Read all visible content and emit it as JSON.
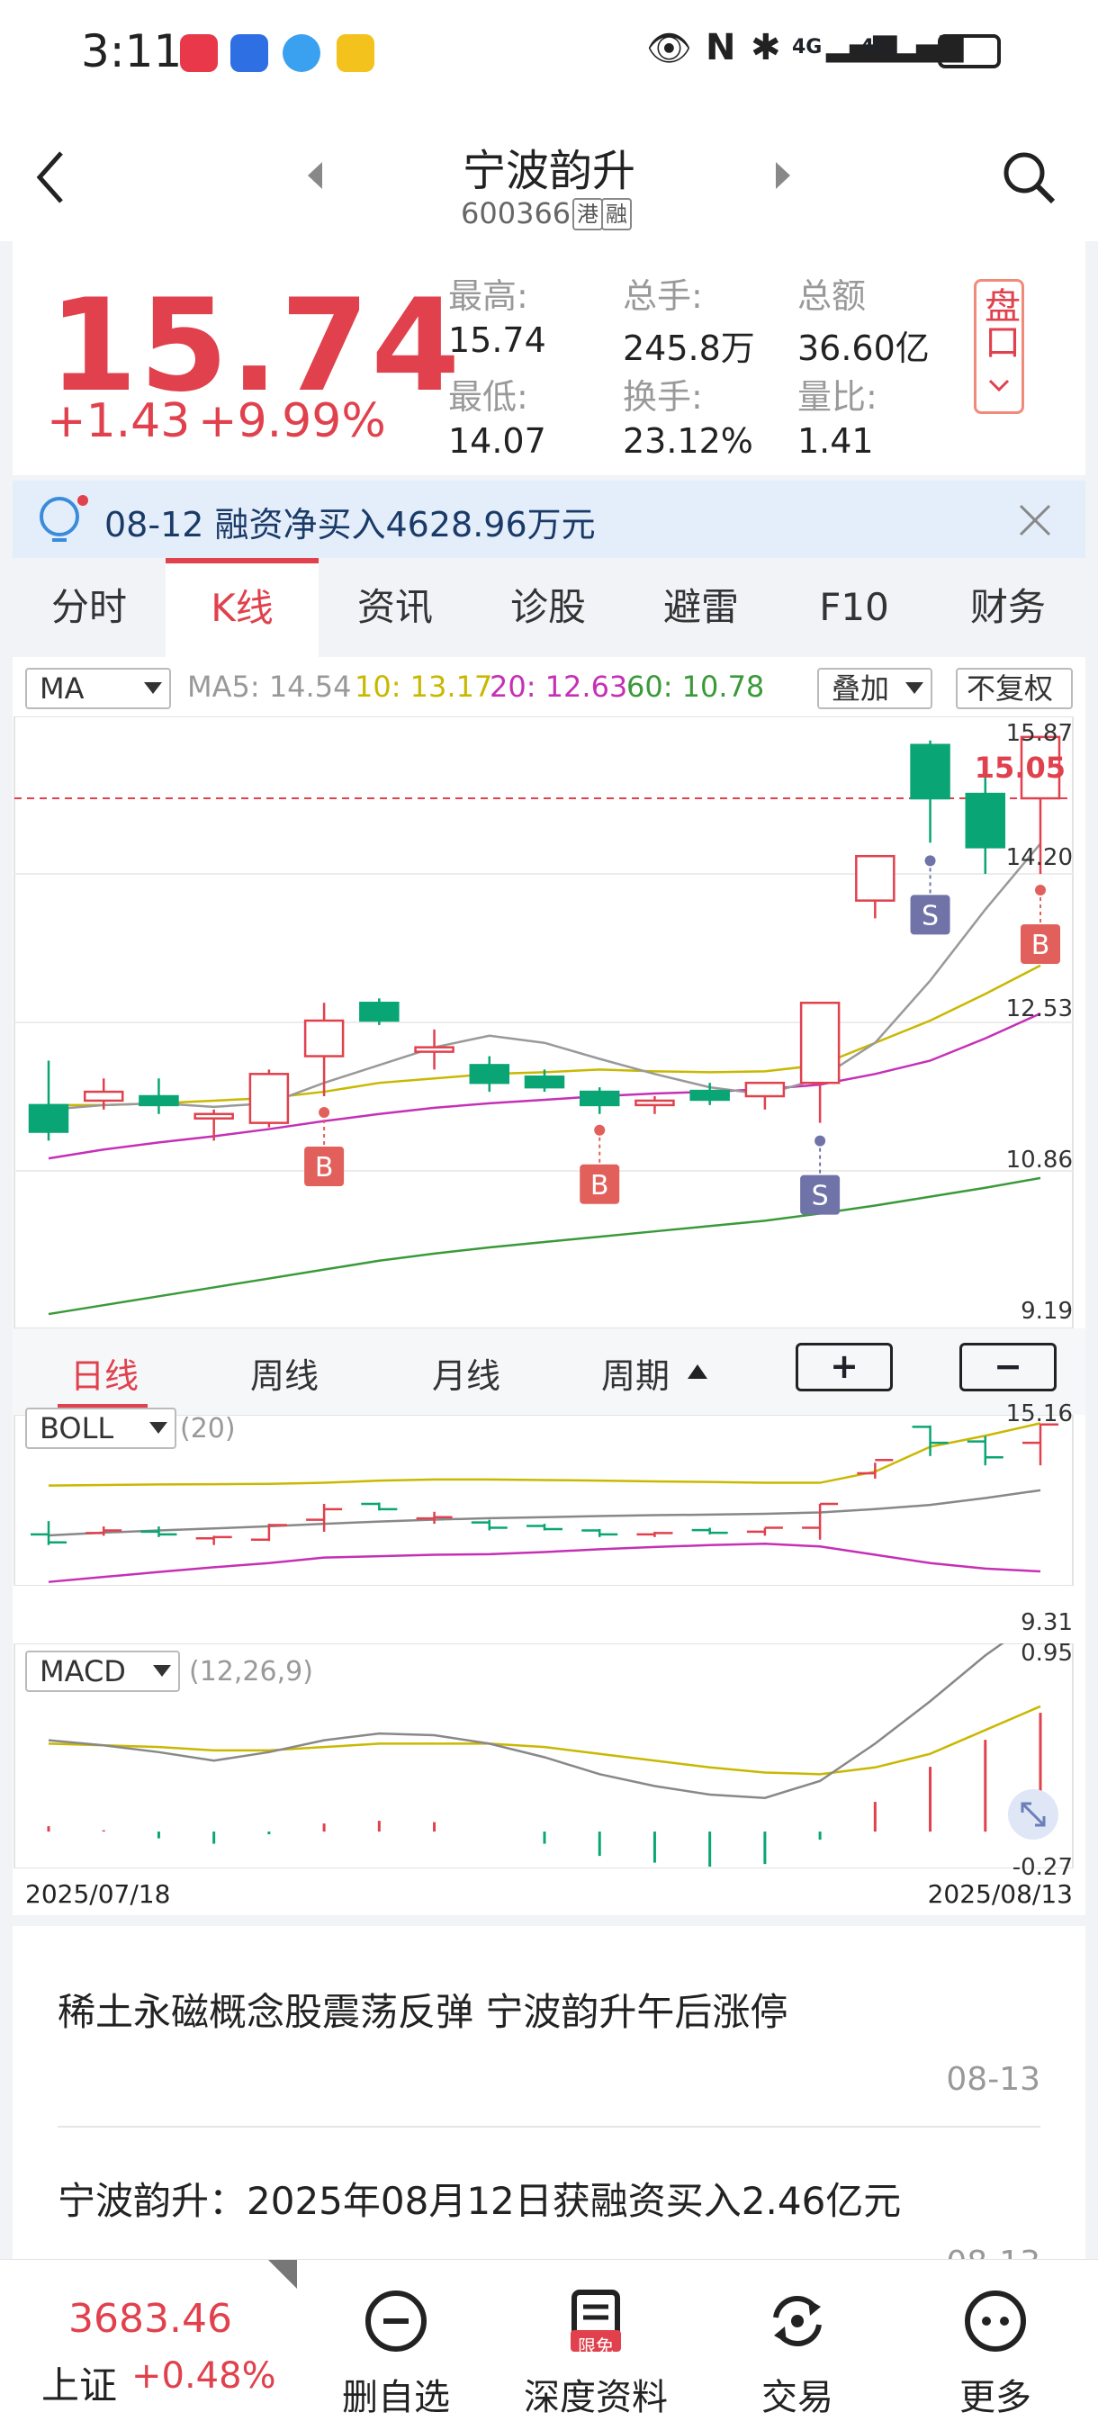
{
  "status_bar": {
    "time": "3:11",
    "network_a": "4G",
    "network_b": "4G"
  },
  "header": {
    "title": "宁波韵升",
    "code": "600366",
    "tag_hk": "港",
    "tag_margin": "融"
  },
  "quote": {
    "price": "15.74",
    "change": "+1.43",
    "change_pct": "+9.99%",
    "fields": [
      {
        "label": "最高:",
        "value": "15.74"
      },
      {
        "label": "总手:",
        "value": "245.8万"
      },
      {
        "label": "总额",
        "value": "36.60亿"
      },
      {
        "label": "最低:",
        "value": "14.07"
      },
      {
        "label": "换手:",
        "value": "23.12%"
      },
      {
        "label": "量比:",
        "value": "1.41"
      }
    ],
    "pankou_label": "盘口"
  },
  "notice": {
    "text": "08-12 融资净买入4628.96万元"
  },
  "tabs": [
    "分时",
    "K线",
    "资讯",
    "诊股",
    "避雷",
    "F10",
    "财务"
  ],
  "active_tab": 1,
  "chart": {
    "ma_selector": "MA",
    "ma_legend": [
      {
        "label": "MA5: 14.54",
        "color": "#999999"
      },
      {
        "label": "10: 13.17",
        "color": "#c9b800"
      },
      {
        "label": "20: 12.63",
        "color": "#c530b5"
      },
      {
        "label": "60: 10.78",
        "color": "#3a9a3a"
      }
    ],
    "overlay_btn": "叠加",
    "adjust_btn": "不复权",
    "price_axis": [
      "15.87",
      "14.20",
      "12.53",
      "10.86",
      "9.19"
    ],
    "current_price_label": "15.05",
    "period_tabs": [
      "日线",
      "周线",
      "月线",
      "周期"
    ],
    "zoom_in": "+",
    "zoom_out": "−",
    "boll_selector": "BOLL",
    "boll_params": "(20)",
    "boll_axis_top": "15.16",
    "boll_axis_bottom": "9.31",
    "macd_selector": "MACD",
    "macd_params": "(12,26,9)",
    "macd_axis_top": "0.95",
    "macd_axis_bottom": "-0.27",
    "date_start": "2025/07/18",
    "date_end": "2025/08/13",
    "signal_buy": "B",
    "signal_sell": "S"
  },
  "chart_data": {
    "type": "candlestick",
    "ylim": [
      9.19,
      15.87
    ],
    "candles": [
      {
        "o": 11.6,
        "h": 12.1,
        "l": 11.2,
        "c": 11.3
      },
      {
        "o": 11.65,
        "h": 11.9,
        "l": 11.55,
        "c": 11.75
      },
      {
        "o": 11.7,
        "h": 11.9,
        "l": 11.5,
        "c": 11.6
      },
      {
        "o": 11.45,
        "h": 11.55,
        "l": 11.2,
        "c": 11.5
      },
      {
        "o": 11.4,
        "h": 12.0,
        "l": 11.35,
        "c": 11.95
      },
      {
        "o": 12.15,
        "h": 12.75,
        "l": 11.7,
        "c": 12.55
      },
      {
        "o": 12.75,
        "h": 12.8,
        "l": 12.5,
        "c": 12.55
      },
      {
        "o": 12.2,
        "h": 12.45,
        "l": 12.0,
        "c": 12.25
      },
      {
        "o": 12.05,
        "h": 12.15,
        "l": 11.75,
        "c": 11.85
      },
      {
        "o": 11.92,
        "h": 12.0,
        "l": 11.75,
        "c": 11.8
      },
      {
        "o": 11.75,
        "h": 11.8,
        "l": 11.5,
        "c": 11.6
      },
      {
        "o": 11.6,
        "h": 11.7,
        "l": 11.5,
        "c": 11.65
      },
      {
        "o": 11.76,
        "h": 11.85,
        "l": 11.6,
        "c": 11.66
      },
      {
        "o": 11.7,
        "h": 11.85,
        "l": 11.55,
        "c": 11.85
      },
      {
        "o": 11.85,
        "h": 12.75,
        "l": 11.4,
        "c": 12.75
      },
      {
        "o": 13.9,
        "h": 14.3,
        "l": 13.7,
        "c": 14.4
      },
      {
        "o": 15.65,
        "h": 15.7,
        "l": 14.55,
        "c": 15.05
      },
      {
        "o": 15.1,
        "h": 15.3,
        "l": 14.2,
        "c": 14.5
      },
      {
        "o": 15.05,
        "h": 15.75,
        "l": 14.2,
        "c": 15.74
      }
    ],
    "ma5": [
      11.55,
      11.6,
      11.62,
      11.58,
      11.62,
      11.85,
      12.05,
      12.25,
      12.38,
      12.3,
      12.12,
      11.95,
      11.8,
      11.72,
      11.9,
      12.3,
      13.0,
      13.8,
      14.54
    ],
    "ma10": [
      11.6,
      11.6,
      11.62,
      11.65,
      11.68,
      11.75,
      11.85,
      11.9,
      11.95,
      11.97,
      12.0,
      11.98,
      11.97,
      11.98,
      12.05,
      12.3,
      12.55,
      12.85,
      13.17
    ],
    "ma20": [
      11.0,
      11.1,
      11.18,
      11.25,
      11.33,
      11.42,
      11.5,
      11.57,
      11.62,
      11.66,
      11.7,
      11.73,
      11.75,
      11.78,
      11.83,
      11.95,
      12.1,
      12.35,
      12.63
    ],
    "ma60": [
      9.25,
      9.35,
      9.45,
      9.55,
      9.65,
      9.75,
      9.85,
      9.93,
      10.0,
      10.06,
      10.12,
      10.18,
      10.24,
      10.3,
      10.38,
      10.47,
      10.57,
      10.67,
      10.78
    ],
    "signals": [
      {
        "i": 5,
        "type": "B"
      },
      {
        "i": 10,
        "type": "B"
      },
      {
        "i": 14,
        "type": "S"
      },
      {
        "i": 16,
        "type": "S"
      },
      {
        "i": 18,
        "type": "B"
      }
    ],
    "boll": {
      "ylim": [
        9.31,
        15.16
      ],
      "upper": [
        12.8,
        12.82,
        12.84,
        12.85,
        12.86,
        12.9,
        12.98,
        13.02,
        13.02,
        13.0,
        12.98,
        12.95,
        12.93,
        12.9,
        12.9,
        13.3,
        14.2,
        14.6,
        15.05
      ],
      "mid": [
        11.0,
        11.1,
        11.18,
        11.25,
        11.33,
        11.42,
        11.5,
        11.57,
        11.62,
        11.66,
        11.7,
        11.73,
        11.75,
        11.78,
        11.83,
        11.95,
        12.1,
        12.35,
        12.63
      ],
      "lower": [
        9.32,
        9.5,
        9.68,
        9.85,
        10.0,
        10.2,
        10.25,
        10.3,
        10.32,
        10.4,
        10.5,
        10.58,
        10.65,
        10.7,
        10.6,
        10.3,
        10.0,
        9.8,
        9.7
      ]
    },
    "macd": {
      "ylim": [
        -0.27,
        0.95
      ],
      "dif": [
        0.22,
        0.19,
        0.15,
        0.1,
        0.15,
        0.22,
        0.26,
        0.25,
        0.2,
        0.12,
        0.02,
        -0.05,
        -0.1,
        -0.12,
        -0.02,
        0.2,
        0.45,
        0.72,
        0.95
      ],
      "dea": [
        0.2,
        0.19,
        0.18,
        0.16,
        0.16,
        0.18,
        0.2,
        0.2,
        0.2,
        0.18,
        0.14,
        0.1,
        0.06,
        0.03,
        0.02,
        0.06,
        0.14,
        0.28,
        0.42
      ],
      "hist": [
        0.04,
        0.01,
        -0.05,
        -0.09,
        -0.02,
        0.06,
        0.08,
        0.07,
        0.0,
        -0.09,
        -0.18,
        -0.23,
        -0.26,
        -0.24,
        -0.06,
        0.22,
        0.48,
        0.68,
        0.88
      ]
    }
  },
  "news": [
    {
      "title": "稀土永磁概念股震荡反弹 宁波韵升午后涨停",
      "date": "08-13"
    },
    {
      "title": "宁波韵升：2025年08月12日获融资买入2.46亿元",
      "date": "08-13"
    }
  ],
  "bottom_bar": {
    "index_value": "3683.46",
    "index_name": "上证",
    "index_change": "+0.48%",
    "items": [
      "删自选",
      "深度资料",
      "交易",
      "更多"
    ],
    "badge": "限免"
  },
  "colors": {
    "up": "#e0414d",
    "down": "#0aa574",
    "accent": "#e0414d"
  }
}
